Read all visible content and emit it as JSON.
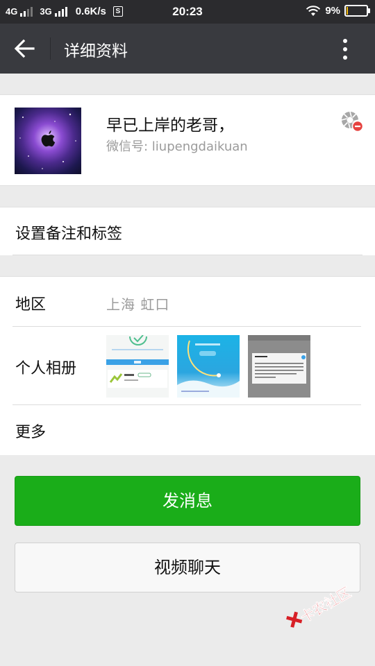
{
  "status_bar": {
    "network1": "4G",
    "network2": "3G",
    "speed": "0.6K/s",
    "sim_badge": "S",
    "time": "20:23",
    "battery_text": "9%",
    "battery_level": 0.09,
    "battery_color": "#f2b90f"
  },
  "app_bar": {
    "title": "详细资料",
    "back_icon": "arrow-left-icon",
    "more_icon": "more-vertical-icon",
    "background": "#393a3f"
  },
  "profile": {
    "nickname": "早已上岸的老哥，",
    "wechat_id_label": "微信号: ",
    "wechat_id": "liupengdaikuan",
    "avatar_icon": "apple-logo-icon",
    "side_icon": "do-not-share-moments-icon"
  },
  "remark": {
    "label": "设置备注和标签"
  },
  "info": {
    "region_label": "地区",
    "region_value": "上海  虹口",
    "album_label": "个人相册",
    "more_label": "更多"
  },
  "actions": {
    "message_label": "发消息",
    "video_call_label": "视频聊天",
    "accent": "#1aad19"
  },
  "watermark": {
    "text": "卡农社区"
  }
}
